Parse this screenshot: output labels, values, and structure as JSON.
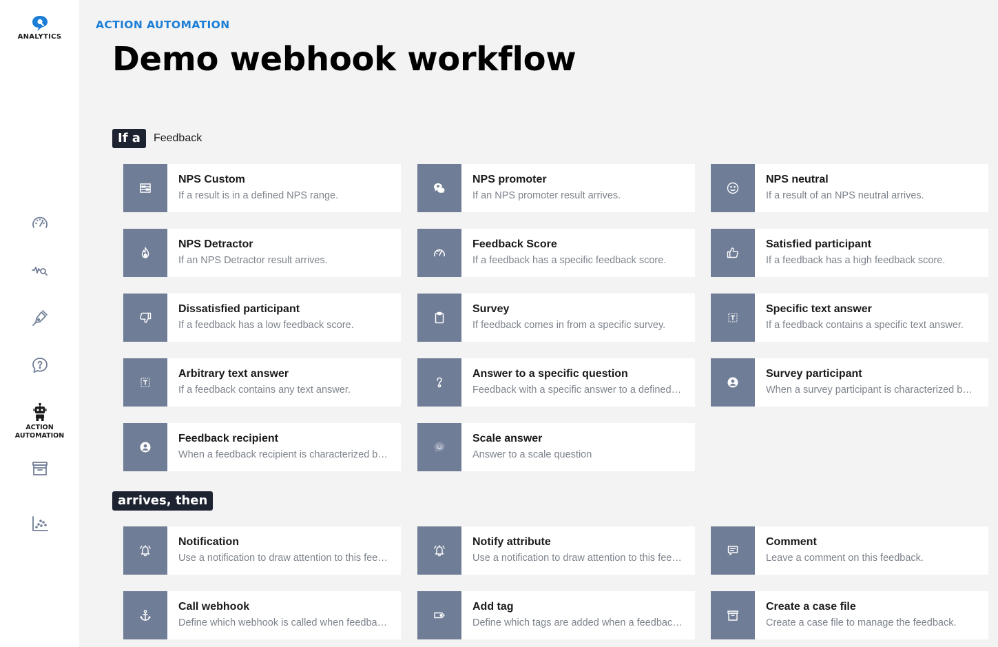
{
  "app": {
    "logo_text": "ANALYTICS"
  },
  "nav": {
    "items": [
      {
        "name": "dashboard",
        "icon": "speedometer-icon"
      },
      {
        "name": "analysis",
        "icon": "pulse-search-icon"
      },
      {
        "name": "editor",
        "icon": "pen-icon"
      },
      {
        "name": "help",
        "icon": "question-bubble-icon"
      },
      {
        "name": "action-automation",
        "icon": "robot-icon",
        "label": "ACTION AUTOMATION",
        "active": true
      },
      {
        "name": "archive",
        "icon": "archive-box-icon"
      },
      {
        "name": "reports",
        "icon": "scatter-chart-icon"
      }
    ]
  },
  "header": {
    "eyebrow": "ACTION AUTOMATION",
    "title": "Demo webhook workflow"
  },
  "trigger_section": {
    "pill": "If a",
    "subject": "Feedback",
    "cards": [
      {
        "title": "NPS Custom",
        "desc": "If a result is in a defined NPS range.",
        "icon": "abacus-icon"
      },
      {
        "title": "NPS promoter",
        "desc": "If an NPS promoter result arrives.",
        "icon": "chat-heart-icon"
      },
      {
        "title": "NPS neutral",
        "desc": "If a result of an NPS neutral arrives.",
        "icon": "neutral-face-icon"
      },
      {
        "title": "NPS Detractor",
        "desc": "If an NPS Detractor result arrives.",
        "icon": "flame-icon"
      },
      {
        "title": "Feedback Score",
        "desc": "If a feedback has a specific feedback score.",
        "icon": "gauge-icon"
      },
      {
        "title": "Satisfied participant",
        "desc": "If a feedback has a high feedback score.",
        "icon": "thumbs-up-icon"
      },
      {
        "title": "Dissatisfied participant",
        "desc": "If a feedback has a low feedback score.",
        "icon": "thumbs-down-icon"
      },
      {
        "title": "Survey",
        "desc": "If feedback comes in from a specific survey.",
        "icon": "clipboard-icon"
      },
      {
        "title": "Specific text answer",
        "desc": "If a feedback contains a specific text answer.",
        "icon": "text-box-icon"
      },
      {
        "title": "Arbitrary text answer",
        "desc": "If a feedback contains any text answer.",
        "icon": "text-box-icon"
      },
      {
        "title": "Answer to a specific question",
        "desc": "Feedback with a specific answer to a defined question.",
        "icon": "question-mark-icon"
      },
      {
        "title": "Survey participant",
        "desc": "When a survey participant is characterized by an attribute.",
        "icon": "user-circle-icon"
      },
      {
        "title": "Feedback recipient",
        "desc": "When a feedback recipient is characterized by an attribute.",
        "icon": "user-circle-icon"
      },
      {
        "title": "Scale answer",
        "desc": "Answer to a scale question",
        "icon": "smile-bubble-icon"
      }
    ]
  },
  "action_section": {
    "pill": "arrives, then",
    "cards": [
      {
        "title": "Notification",
        "desc": "Use a notification to draw attention to this feedback.",
        "icon": "bell-ring-icon"
      },
      {
        "title": "Notify attribute",
        "desc": "Use a notification to draw attention to this feedback.",
        "icon": "bell-ring-icon"
      },
      {
        "title": "Comment",
        "desc": "Leave a comment on this feedback.",
        "icon": "comment-icon"
      },
      {
        "title": "Call webhook",
        "desc": "Define which webhook is called when feedback arrives.",
        "icon": "anchor-icon"
      },
      {
        "title": "Add tag",
        "desc": "Define which tags are added when a feedback arrives.",
        "icon": "tag-icon"
      },
      {
        "title": "Create a case file",
        "desc": "Create a case file to manage the feedback.",
        "icon": "archive-box-icon"
      }
    ]
  },
  "colors": {
    "accent": "#1c7ed6",
    "icon_tile": "#6f7d96",
    "pill": "#1d2330",
    "background": "#f3f3f3"
  }
}
